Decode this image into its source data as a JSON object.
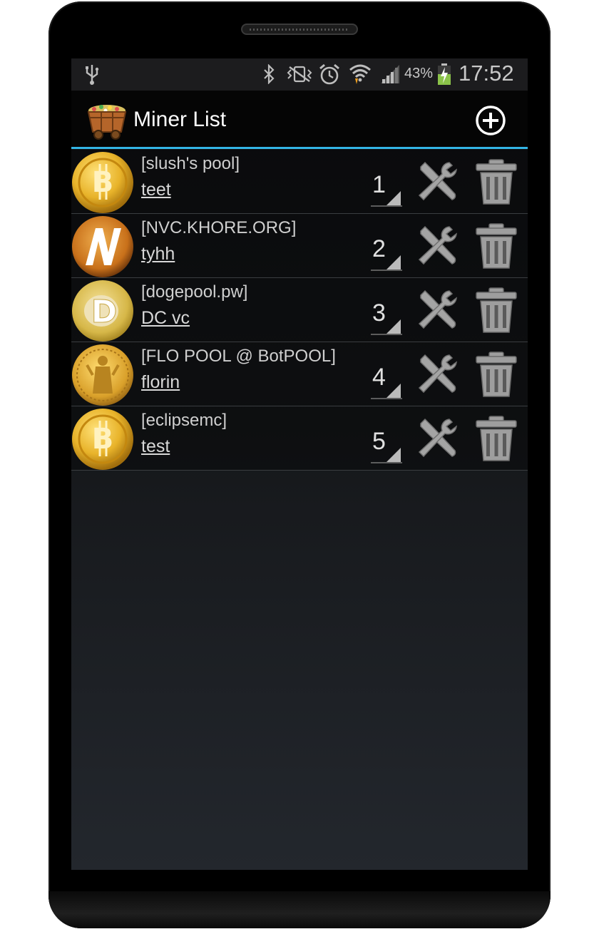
{
  "status_bar": {
    "battery_percent": "43%",
    "time": "17:52",
    "icons": [
      "usb-icon",
      "bluetooth-icon",
      "vibrate-icon",
      "alarm-icon",
      "wifi-icon",
      "signal-icon",
      "battery-charging-icon"
    ]
  },
  "action_bar": {
    "title": "Miner List",
    "add_icon": "add-circle-icon",
    "app_icon": "mine-cart-icon"
  },
  "colors": {
    "accent": "#33b5e5",
    "coin_gold": "#e8b32a",
    "icon_gray": "#9a9a9a"
  },
  "miners": [
    {
      "pool": "[slush's pool]",
      "name": "teet",
      "order": "1",
      "coin": "bitcoin"
    },
    {
      "pool": "[NVC.KHORE.ORG]",
      "name": "tyhh",
      "order": "2",
      "coin": "novacoin"
    },
    {
      "pool": "[dogepool.pw]",
      "name": "DC vc",
      "order": "3",
      "coin": "dogecoin"
    },
    {
      "pool": "[FLO POOL @ BotPOOL]",
      "name": "florin",
      "order": "4",
      "coin": "florincoin"
    },
    {
      "pool": "[eclipsemc]",
      "name": "test",
      "order": "5",
      "coin": "bitcoin"
    }
  ]
}
